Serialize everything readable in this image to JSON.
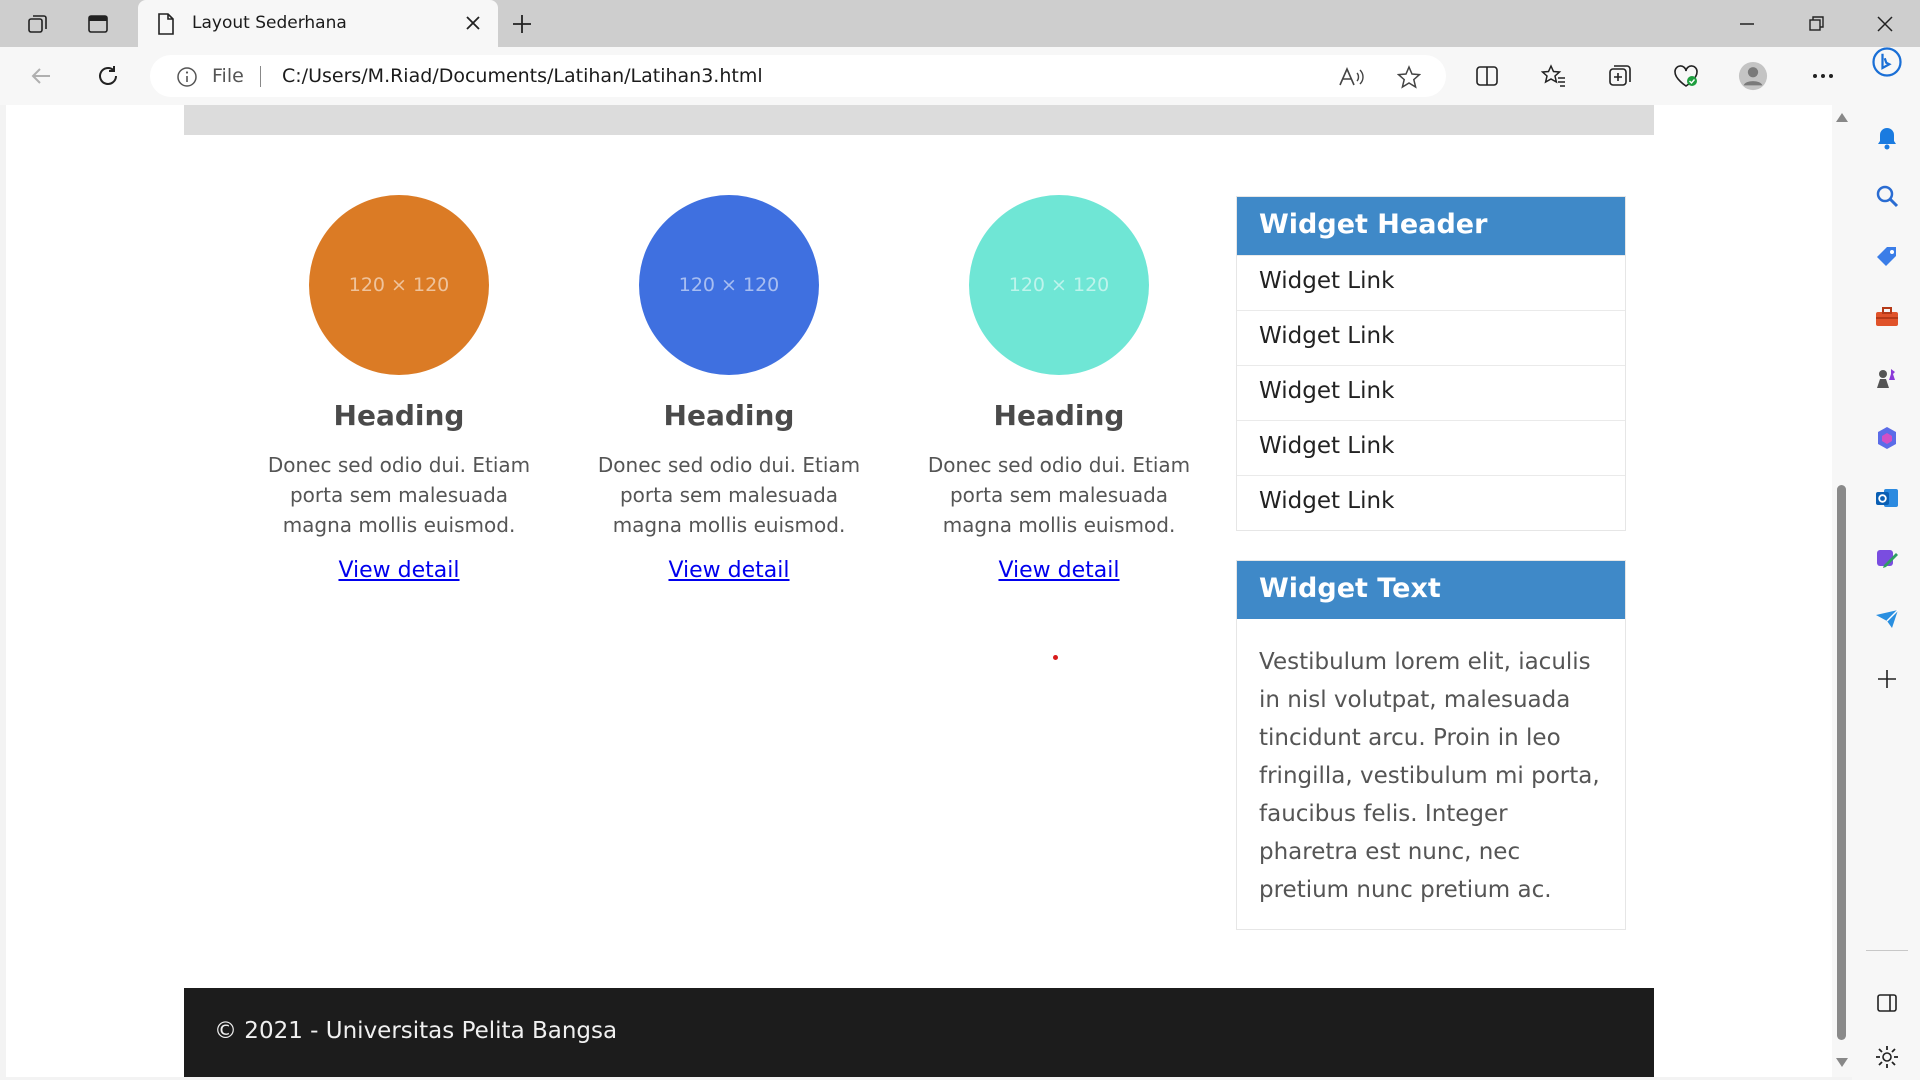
{
  "browser": {
    "tab_title": "Layout Sederhana",
    "omnibox_scheme": "File",
    "url": "C:/Users/M.Riad/Documents/Latihan/Latihan3.html"
  },
  "features": [
    {
      "image_label": "120 × 120",
      "color": "#db7b25",
      "heading": "Heading",
      "text": "Donec sed odio dui. Etiam porta sem malesuada magna mollis euismod.",
      "link": "View detail"
    },
    {
      "image_label": "120 × 120",
      "color": "#3f70e0",
      "heading": "Heading",
      "text": "Donec sed odio dui. Etiam porta sem malesuada magna mollis euismod.",
      "link": "View detail"
    },
    {
      "image_label": "120 × 120",
      "color": "#6fe6d5",
      "heading": "Heading",
      "text": "Donec sed odio dui. Etiam porta sem malesuada magna mollis euismod.",
      "link": "View detail"
    }
  ],
  "widget_links": {
    "header": "Widget Header",
    "links": [
      "Widget Link",
      "Widget Link",
      "Widget Link",
      "Widget Link",
      "Widget Link"
    ]
  },
  "widget_text": {
    "header": "Widget Text",
    "body": "Vestibulum lorem elit, iaculis in nisl volutpat, malesuada tincidunt arcu. Proin in leo fringilla, vestibulum mi porta, faucibus felis. Integer pharetra est nunc, nec pretium nunc pretium ac."
  },
  "footer": {
    "text": "© 2021 - Universitas Pelita Bangsa"
  },
  "colors": {
    "widget_header": "#3f89c8",
    "footer_bg": "#1c1c1c",
    "link": "#0000ee"
  }
}
